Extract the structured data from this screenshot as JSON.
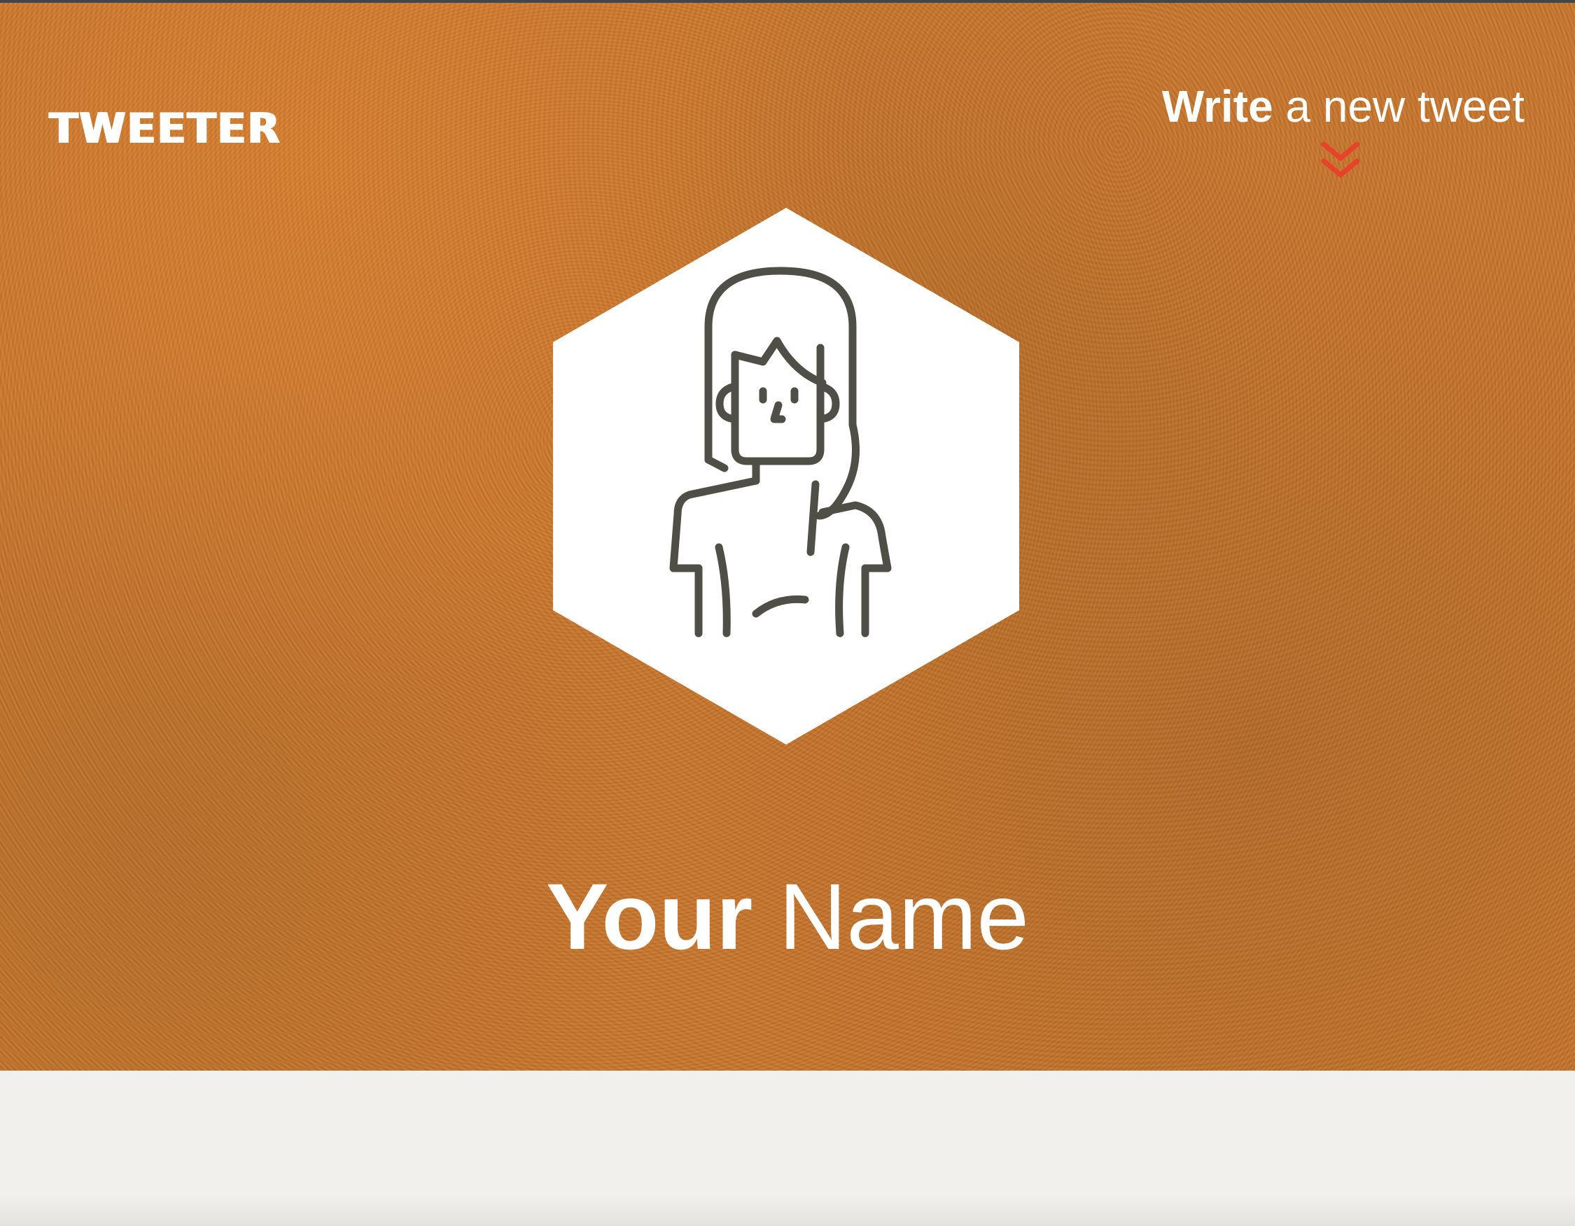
{
  "header": {
    "brand": "TWEETER",
    "write_action": {
      "strong": "Write",
      "rest": " a new tweet",
      "chevron_icon": "double-chevron-down-icon"
    }
  },
  "profile": {
    "avatar_icon": "woman-avatar-icon",
    "name_strong": "Your",
    "name_rest": " Name"
  },
  "colors": {
    "hero_bg": "#c9762b",
    "accent": "#e8422a",
    "avatar_stroke": "#4f4f48",
    "lower_bg": "#f1f0ec"
  }
}
